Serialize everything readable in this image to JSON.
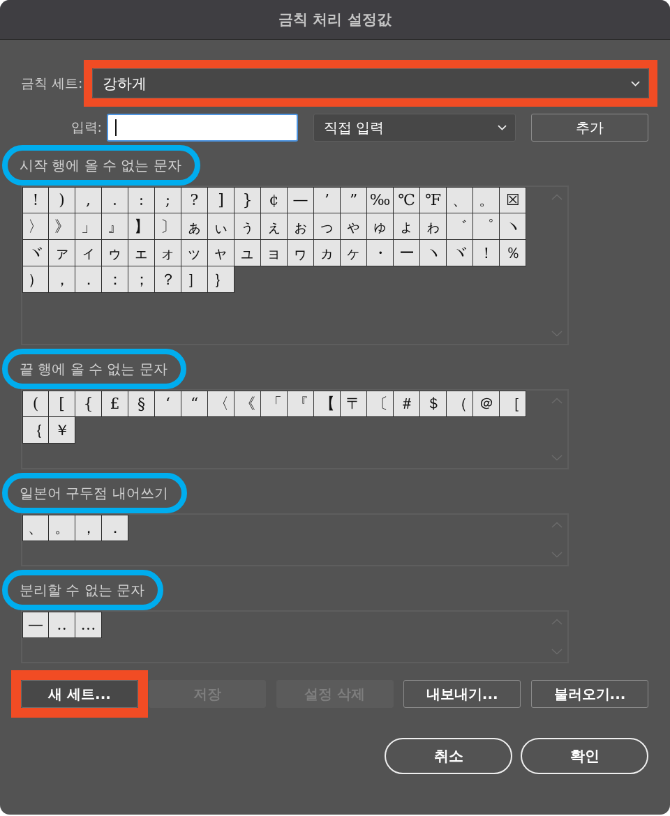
{
  "window": {
    "title": "금칙 처리 설정값"
  },
  "kinsoku_set": {
    "label": "금칙 세트:",
    "value": "강하게",
    "highlighted": true
  },
  "input": {
    "label": "입력:",
    "focused": true,
    "mode": "직접 입력",
    "add_button": "추가"
  },
  "sections": [
    {
      "label": "시작 행에 올 수 없는 문자",
      "highlighted": true,
      "chars": [
        "!",
        ")",
        ",",
        ".",
        ":",
        ";",
        "?",
        "]",
        "}",
        "¢",
        "—",
        "’",
        "”",
        "‰",
        "℃",
        "℉",
        "、",
        "。",
        "☒",
        "〉",
        "》",
        "」",
        "』",
        "】",
        "〕",
        "ぁ",
        "ぃ",
        "ぅ",
        "ぇ",
        "ぉ",
        "っ",
        "ゃ",
        "ゅ",
        "ょ",
        "ゎ",
        "゛",
        "゜",
        "ヽ",
        "ヾ",
        "ァ",
        "ィ",
        "ゥ",
        "ェ",
        "ォ",
        "ッ",
        "ャ",
        "ュ",
        "ョ",
        "ヮ",
        "ヵ",
        "ヶ",
        "・",
        "ー",
        "ヽ",
        "ヾ",
        "！",
        "％",
        "）",
        "，",
        "．",
        "：",
        "；",
        "？",
        "］",
        "｝"
      ]
    },
    {
      "label": "끝 행에 올 수 없는 문자",
      "highlighted": true,
      "chars": [
        "(",
        "[",
        "{",
        "£",
        "§",
        "‘",
        "“",
        "〈",
        "《",
        "「",
        "『",
        "【",
        "〒",
        "〔",
        "＃",
        "＄",
        "（",
        "＠",
        "［",
        "｛",
        "￥"
      ]
    },
    {
      "label": "일본어 구두점 내어쓰기",
      "highlighted": true,
      "chars": [
        "、",
        "。",
        "，",
        "．"
      ]
    },
    {
      "label": "분리할 수 없는 문자",
      "highlighted": true,
      "chars": [
        "—",
        "‥",
        "…"
      ]
    }
  ],
  "buttons": [
    {
      "label": "새 세트...",
      "disabled": false,
      "highlighted": true
    },
    {
      "label": "저장",
      "disabled": true,
      "highlighted": false
    },
    {
      "label": "설정 삭제",
      "disabled": true,
      "highlighted": false
    },
    {
      "label": "내보내기...",
      "disabled": false,
      "highlighted": false
    },
    {
      "label": "불러오기...",
      "disabled": false,
      "highlighted": false
    }
  ],
  "dialog_buttons": [
    "취소",
    "확인"
  ]
}
